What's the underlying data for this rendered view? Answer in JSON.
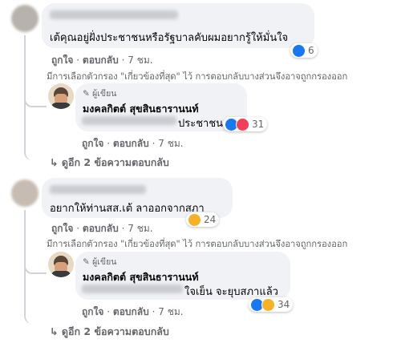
{
  "comments": [
    {
      "text": "เต้คุณอยู่ฝั่งประชาชนหรือรัฐบาลคับผมอยากรู้ให้มั่นใจ",
      "reaction_count": "6",
      "like_label": "ถูกใจ",
      "reply_label": "ตอบกลับ",
      "time": "7 ชม.",
      "filter_note": "มีการเลือกตัวกรอง \"เกี่ยวข้องที่สุด\" ไว้ การตอบกลับบางส่วนจึงอาจถูกกรองออก",
      "reply": {
        "author_badge": "ผู้เขียน",
        "name": "มงคลกิตต์ สุขสินธารานนท์",
        "text": "ประชาชน",
        "reaction_count": "31",
        "like_label": "ถูกใจ",
        "reply_label": "ตอบกลับ",
        "time": "7 ชม."
      },
      "view_more": "ดูอีก 2 ข้อความตอบกลับ"
    },
    {
      "text": "อยากให้ท่านสส.เต้ ลาออกจากสภา",
      "reaction_count": "24",
      "like_label": "ถูกใจ",
      "reply_label": "ตอบกลับ",
      "time": "7 ชม.",
      "filter_note": "มีการเลือกตัวกรอง \"เกี่ยวข้องที่สุด\" ไว้ การตอบกลับบางส่วนจึงอาจถูกกรองออก",
      "reply": {
        "author_badge": "ผู้เขียน",
        "name": "มงคลกิตต์ สุขสินธารานนท์",
        "text": "ใจเย็น จะยุบสภาแล้ว",
        "reaction_count": "34",
        "like_label": "ถูกใจ",
        "reply_label": "ตอบกลับ",
        "time": "7 ชม."
      },
      "view_more": "ดูอีก 2 ข้อความตอบกลับ"
    }
  ],
  "separator": "·",
  "icons": [
    "like-icon",
    "love-icon",
    "haha-icon",
    "pencil-icon",
    "reply-arrow-icon"
  ],
  "colors": {
    "like": "#1877f2",
    "love": "#f33e58",
    "haha": "#f7b125",
    "bubble": "#f0f2f5",
    "muted": "#65676b"
  }
}
